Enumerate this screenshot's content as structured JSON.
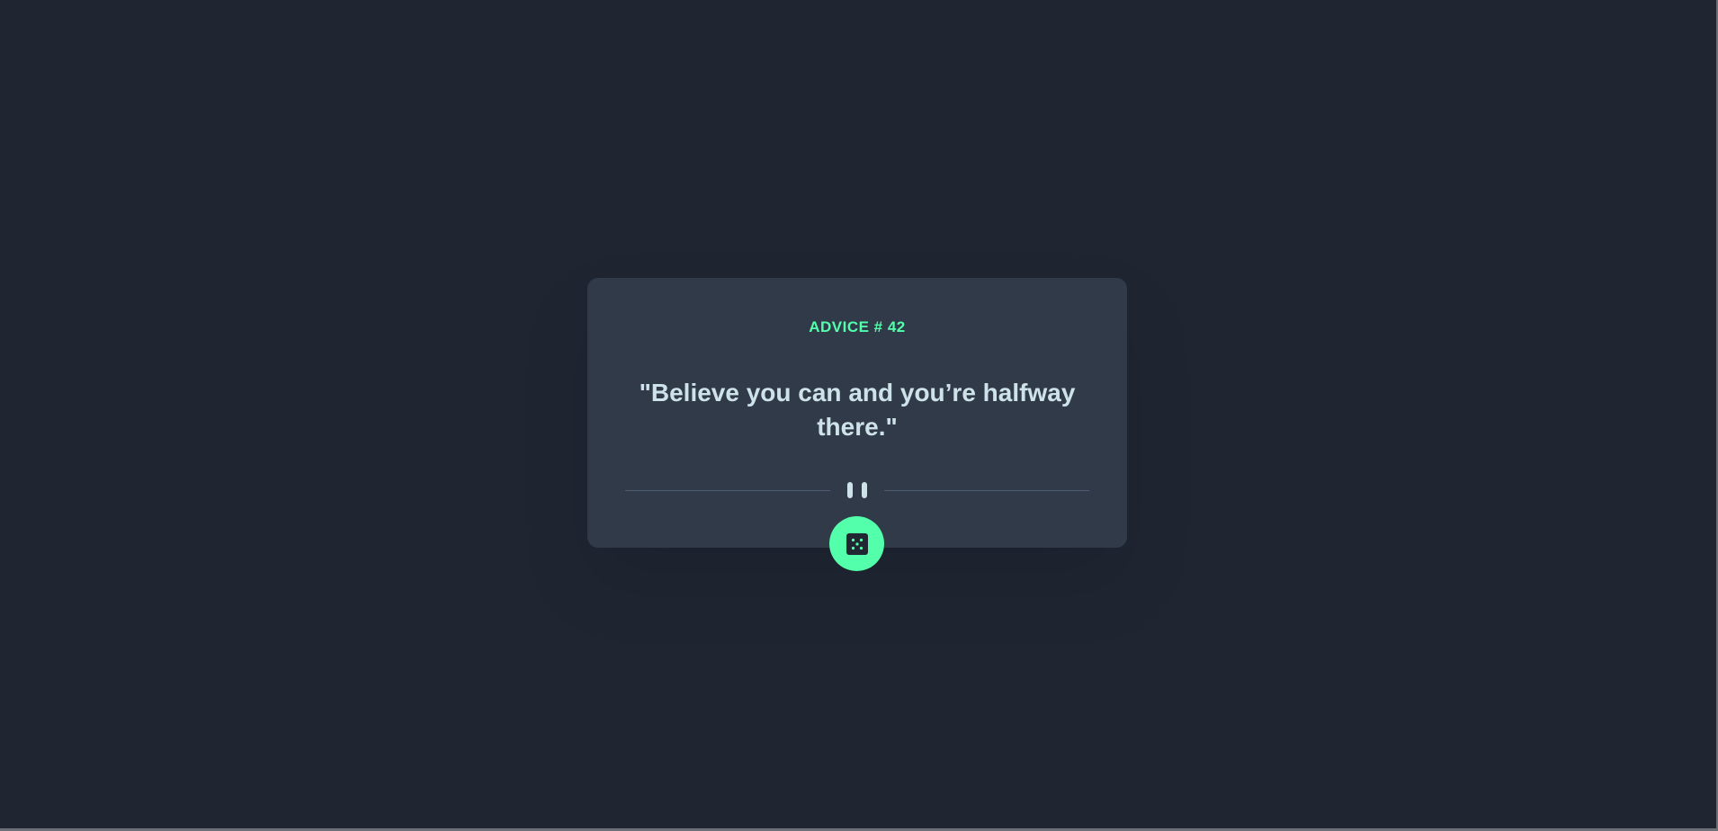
{
  "card": {
    "advice_label": "ADVICE # 42",
    "advice_text": "\"Believe you can and you’re halfway there.\""
  },
  "icons": {
    "divider": "pause-icon",
    "button": "dice-icon"
  },
  "colors": {
    "background": "#1f2632",
    "card": "#313a49",
    "accent": "#53ffaa",
    "text": "#cee3e9",
    "divider": "#4f5d74"
  }
}
